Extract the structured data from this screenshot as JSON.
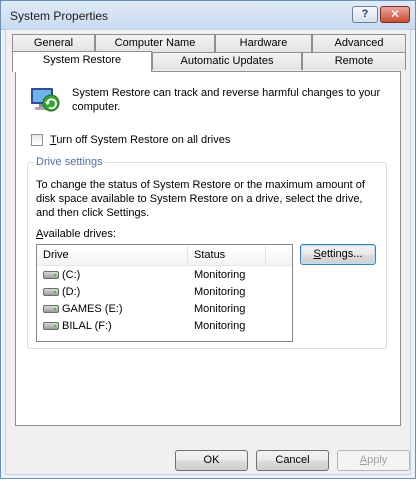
{
  "window": {
    "title": "System Properties",
    "help_label": "?",
    "close_label": "✕"
  },
  "tabs": {
    "row_back": [
      {
        "label": "General"
      },
      {
        "label": "Computer Name"
      },
      {
        "label": "Hardware"
      },
      {
        "label": "Advanced"
      }
    ],
    "row_front": [
      {
        "label": "System Restore",
        "active": true
      },
      {
        "label": "Automatic Updates"
      },
      {
        "label": "Remote"
      }
    ]
  },
  "system_restore": {
    "icon": "system-restore-icon",
    "intro_text": "System Restore can track and reverse harmful changes to your computer.",
    "turn_off_checkbox": {
      "label_prefix": "T",
      "label_rest": "urn off System Restore on all drives",
      "checked": false
    }
  },
  "drive_settings": {
    "group_label": "Drive settings",
    "description": "To change the status of System Restore or the maximum amount of disk space available to System Restore on a drive, select the drive, and then click Settings.",
    "available_prefix": "A",
    "available_rest": "vailable drives:",
    "columns": {
      "drive": "Drive",
      "status": "Status"
    },
    "drives": [
      {
        "name": "(C:)",
        "status": "Monitoring",
        "icon": "hard-drive-icon"
      },
      {
        "name": "(D:)",
        "status": "Monitoring",
        "icon": "hard-drive-icon"
      },
      {
        "name": "GAMES (E:)",
        "status": "Monitoring",
        "icon": "hard-drive-icon"
      },
      {
        "name": "BILAL (F:)",
        "status": "Monitoring",
        "icon": "hard-drive-icon"
      }
    ],
    "settings_prefix": "S",
    "settings_rest": "ettings..."
  },
  "buttons": {
    "ok": "OK",
    "cancel": "Cancel",
    "apply_prefix": "A",
    "apply_rest": "pply",
    "apply_enabled": false
  },
  "colors": {
    "group_label": "#4c6fa0",
    "close_button": "#c74d37",
    "disabled_text": "#a0a0a0"
  }
}
